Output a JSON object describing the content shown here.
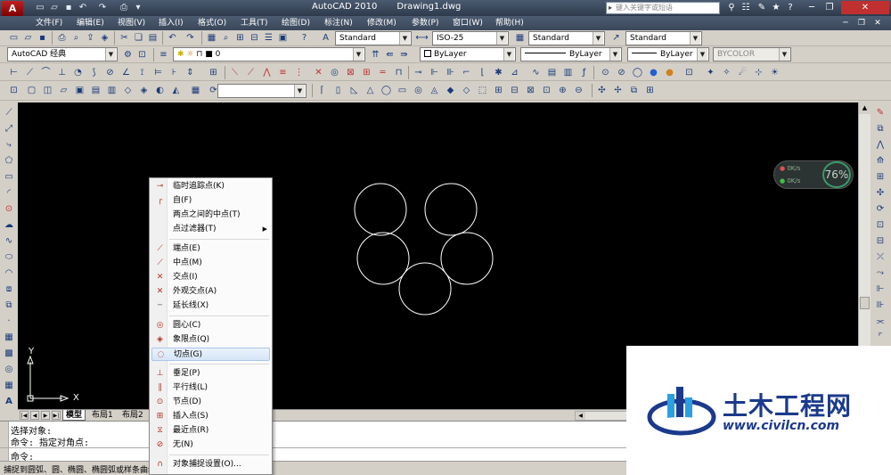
{
  "titlebar": {
    "app": "AutoCAD 2010",
    "file": "Drawing1.dwg",
    "search_placeholder": "键入关键字或短语"
  },
  "menus": [
    "文件(F)",
    "编辑(E)",
    "视图(V)",
    "插入(I)",
    "格式(O)",
    "工具(T)",
    "绘图(D)",
    "标注(N)",
    "修改(M)",
    "参数(P)",
    "窗口(W)",
    "帮助(H)"
  ],
  "styles": {
    "text_style": "Standard",
    "dim_style": "ISO-25",
    "table_style": "Standard",
    "multileader_style": "Standard"
  },
  "layers": {
    "workspace": "AutoCAD 经典",
    "current_layer": "0",
    "color": "ByLayer",
    "linetype": "ByLayer",
    "lineweight": "ByLayer",
    "plot_style": "BYCOLOR"
  },
  "perf": {
    "up": "0K/s",
    "down": "0K/s",
    "percent": "76%"
  },
  "ucs": {
    "x": "X",
    "y": "Y"
  },
  "tabs": [
    "模型",
    "布局1",
    "布局2"
  ],
  "command": {
    "history": [
      "选择对象:",
      "命令: 指定对角点:"
    ],
    "prompt": "命令:"
  },
  "status_text": "捕捉到圆弧、圆、椭圆、椭圆弧或样条曲线...",
  "context_menu": {
    "items": [
      {
        "label": "临时追踪点(K)",
        "icon": "track-icon",
        "glyph": "⊸"
      },
      {
        "label": "自(F)",
        "icon": "from-icon",
        "glyph": "┌"
      },
      {
        "label": "两点之间的中点(T)",
        "icon": "",
        "glyph": ""
      },
      {
        "label": "点过滤器(T)",
        "icon": "",
        "glyph": "",
        "submenu": true
      },
      {
        "label": "端点(E)",
        "icon": "endpoint-icon",
        "glyph": "⟋"
      },
      {
        "label": "中点(M)",
        "icon": "midpoint-icon",
        "glyph": "⟋"
      },
      {
        "label": "交点(I)",
        "icon": "intersection-icon",
        "glyph": "✕"
      },
      {
        "label": "外观交点(A)",
        "icon": "apparent-intersection-icon",
        "glyph": "✕"
      },
      {
        "label": "延长线(X)",
        "icon": "extension-icon",
        "glyph": "┄"
      },
      {
        "label": "圆心(C)",
        "icon": "center-icon",
        "glyph": "◎"
      },
      {
        "label": "象限点(Q)",
        "icon": "quadrant-icon",
        "glyph": "◈"
      },
      {
        "label": "切点(G)",
        "icon": "tangent-icon",
        "glyph": "◌"
      },
      {
        "label": "垂足(P)",
        "icon": "perpendicular-icon",
        "glyph": "⊥"
      },
      {
        "label": "平行线(L)",
        "icon": "parallel-icon",
        "glyph": "∥"
      },
      {
        "label": "节点(D)",
        "icon": "node-icon",
        "glyph": "⊙"
      },
      {
        "label": "插入点(S)",
        "icon": "insert-icon",
        "glyph": "⊞"
      },
      {
        "label": "最近点(R)",
        "icon": "nearest-icon",
        "glyph": "⧖"
      },
      {
        "label": "无(N)",
        "icon": "none-icon",
        "glyph": "⊘"
      },
      {
        "label": "对象捕捉设置(O)...",
        "icon": "osnap-settings-icon",
        "glyph": "∩"
      }
    ]
  },
  "watermark": {
    "name": "土木工程网",
    "url": "www.civilcn.com"
  },
  "colors": {
    "accent": "#1b3a8c",
    "canvas": "#000000",
    "arrow": "#e02020"
  }
}
